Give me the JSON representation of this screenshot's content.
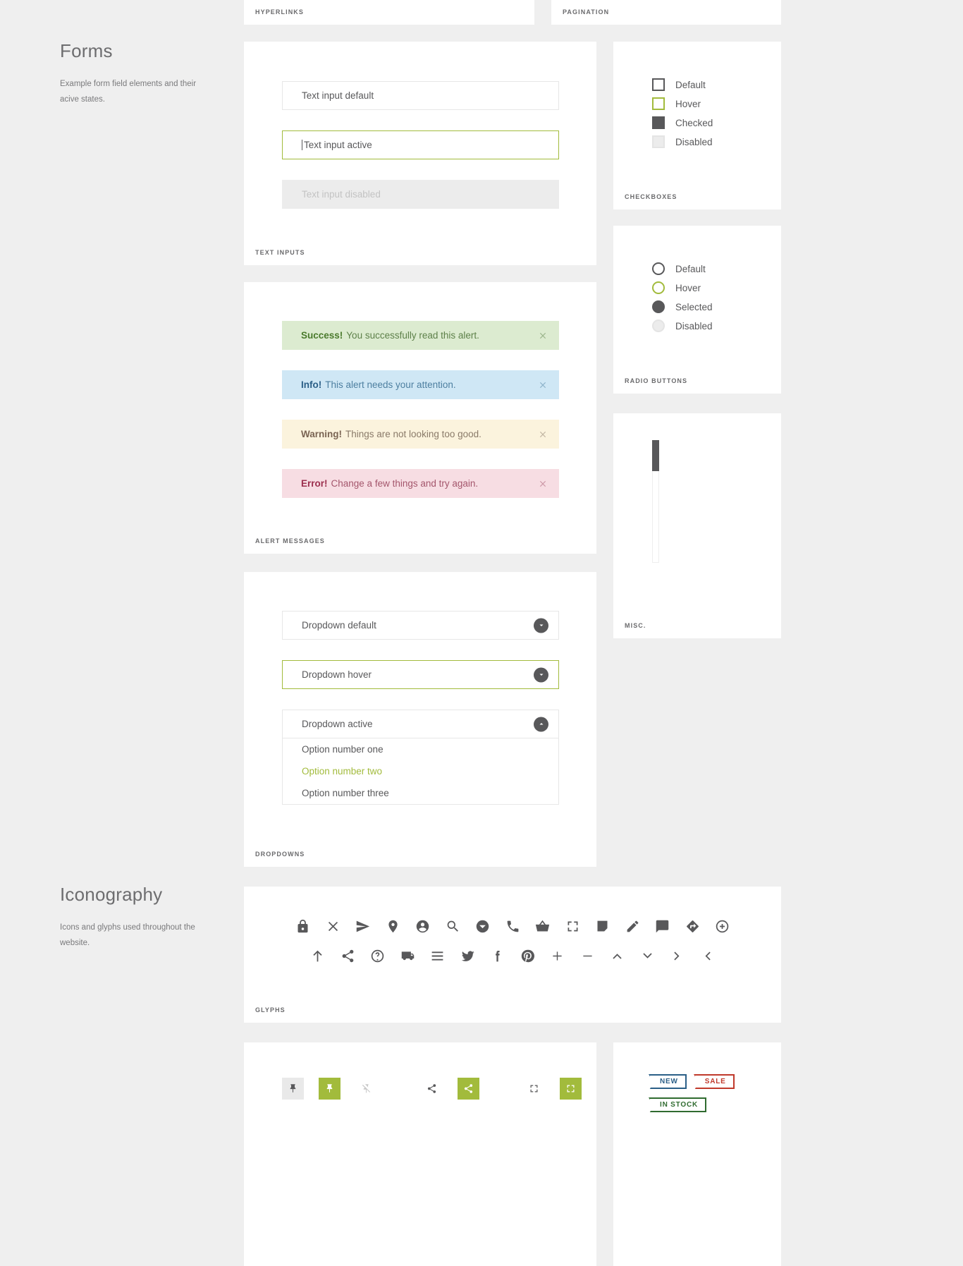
{
  "sections": {
    "forms": {
      "title": "Forms",
      "desc": "Example form field elements and their acive states."
    },
    "iconography": {
      "title": "Iconography",
      "desc": "Icons and glyphs used throughout the website."
    }
  },
  "stubs": {
    "hyperlinks_label": "HYPERLINKS",
    "pagination_label": "PAGINATION"
  },
  "text_inputs": {
    "card_label": "TEXT INPUTS",
    "default": "Text input default",
    "active": "Text input active",
    "disabled": "Text input disabled"
  },
  "checkboxes": {
    "card_label": "CHECKBOXES",
    "items": [
      {
        "label": "Default",
        "state": "default"
      },
      {
        "label": "Hover",
        "state": "hover"
      },
      {
        "label": "Checked",
        "state": "checked"
      },
      {
        "label": "Disabled",
        "state": "disabled"
      }
    ]
  },
  "radios": {
    "card_label": "RADIO BUTTONS",
    "items": [
      {
        "label": "Default",
        "state": "default"
      },
      {
        "label": "Hover",
        "state": "hover"
      },
      {
        "label": "Selected",
        "state": "selected"
      },
      {
        "label": "Disabled",
        "state": "disabled"
      }
    ]
  },
  "misc": {
    "card_label": "MISC."
  },
  "alerts": {
    "card_label": "ALERT MESSAGES",
    "items": [
      {
        "type": "success",
        "strong": "Success!",
        "text": "You successfully read this alert."
      },
      {
        "type": "info",
        "strong": "Info!",
        "text": "This alert needs your attention."
      },
      {
        "type": "warning",
        "strong": "Warning!",
        "text": "Things are not looking too good."
      },
      {
        "type": "error",
        "strong": "Error!",
        "text": "Change a few things and try again."
      }
    ]
  },
  "dropdowns": {
    "card_label": "DROPDOWNS",
    "default": "Dropdown default",
    "hover": "Dropdown hover",
    "active": "Dropdown active",
    "options": [
      {
        "label": "Option number one",
        "highlighted": false
      },
      {
        "label": "Option number two",
        "highlighted": true
      },
      {
        "label": "Option number three",
        "highlighted": false
      }
    ]
  },
  "glyphs": {
    "card_label": "GLYPHS",
    "row1": [
      "lock-icon",
      "close-icon",
      "send-icon",
      "location-pin-icon",
      "account-circle-icon",
      "search-icon",
      "chevron-down-circle-icon",
      "phone-icon",
      "basket-icon",
      "fullscreen-icon",
      "note-icon",
      "pencil-icon",
      "comment-icon",
      "directions-icon",
      "plus-circle-icon"
    ],
    "row2": [
      "arrow-up-icon",
      "share-icon",
      "help-circle-icon",
      "truck-icon",
      "menu-icon",
      "twitter-icon",
      "facebook-icon",
      "pinterest-icon",
      "plus-icon",
      "minus-icon",
      "chevron-up-icon",
      "chevron-down-icon",
      "chevron-right-icon",
      "chevron-left-icon"
    ]
  },
  "buttons": {
    "items": [
      {
        "name": "pin-icon",
        "style": "grey"
      },
      {
        "name": "pin-icon",
        "style": "green"
      },
      {
        "name": "unpin-icon",
        "style": "plain"
      },
      {
        "name": "share-icon",
        "style": "plain"
      },
      {
        "name": "share-icon",
        "style": "green"
      },
      {
        "name": "fullscreen-icon",
        "style": "plain"
      },
      {
        "name": "fullscreen-icon",
        "style": "green"
      }
    ]
  },
  "badges": {
    "items": [
      {
        "label": "NEW",
        "color": "#2b5f87",
        "kind": "new"
      },
      {
        "label": "SALE",
        "color": "#c0392b",
        "kind": "sale"
      },
      {
        "label": "IN STOCK",
        "color": "#2f6b2f",
        "kind": "stock"
      }
    ]
  },
  "colors": {
    "accent_green": "#a2bb3c",
    "text": "#58585a",
    "page_bg": "#efefef"
  }
}
